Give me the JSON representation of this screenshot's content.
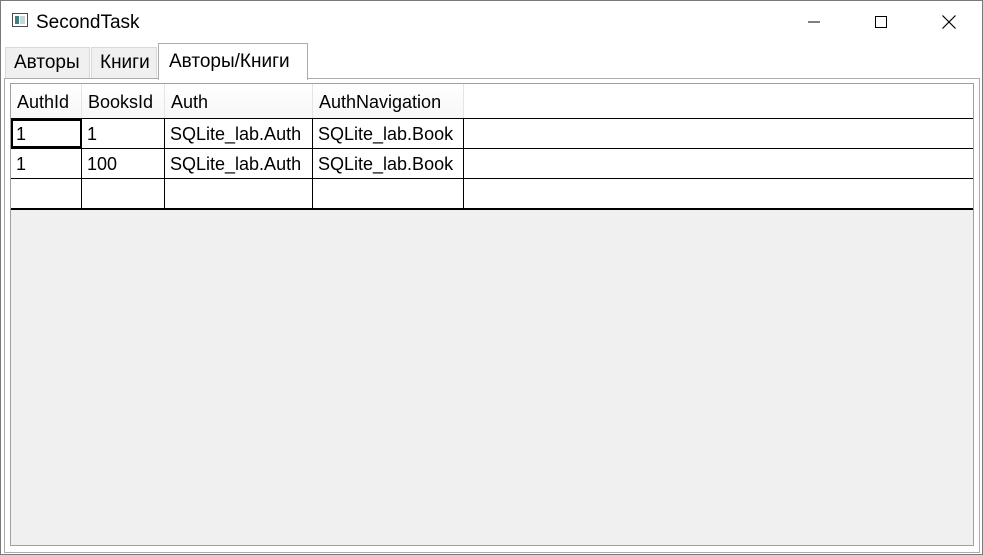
{
  "window": {
    "title": "SecondTask",
    "icon": "app-window-icon",
    "controls": {
      "minimize": "minimize-icon",
      "maximize": "maximize-icon",
      "close": "close-icon"
    }
  },
  "tabs": [
    {
      "label": "Авторы",
      "active": false
    },
    {
      "label": "Книги",
      "active": false
    },
    {
      "label": "Авторы/Книги",
      "active": true
    }
  ],
  "grid": {
    "columns": [
      "AuthId",
      "BooksId",
      "Auth",
      "AuthNavigation"
    ],
    "rows": [
      [
        "1",
        "1",
        "SQLite_lab.Auth",
        "SQLite_lab.Book"
      ],
      [
        "1",
        "100",
        "SQLite_lab.Auth",
        "SQLite_lab.Book"
      ],
      [
        "",
        "",
        "",
        ""
      ]
    ]
  }
}
